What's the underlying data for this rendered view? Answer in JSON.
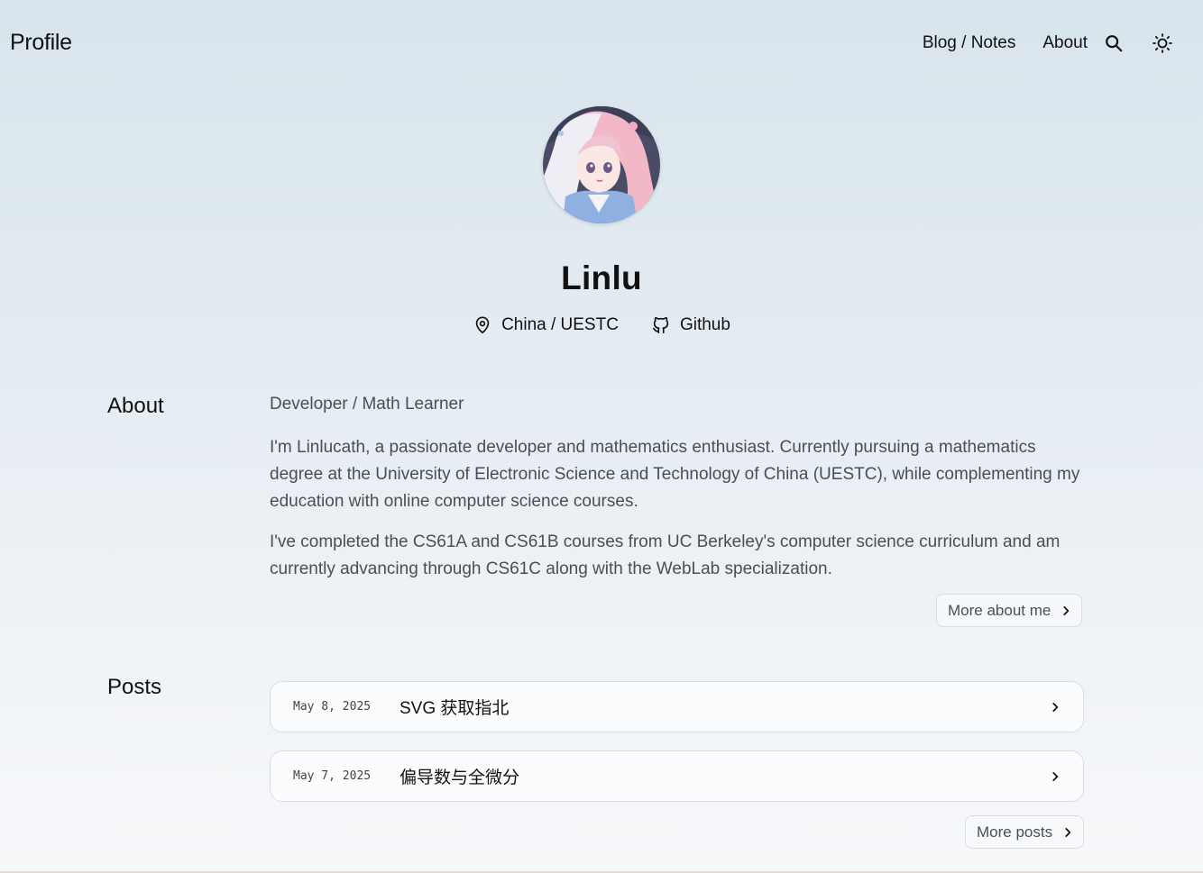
{
  "nav": {
    "brand": "Profile",
    "links": [
      "Blog / Notes",
      "About"
    ],
    "search_icon": "search-icon",
    "theme_icon": "sun-icon"
  },
  "profile": {
    "name": "Linlu",
    "location": "China / UESTC",
    "location_icon": "location-pin-icon",
    "github_label": "Github",
    "github_icon": "github-icon"
  },
  "about": {
    "title": "About",
    "role": "Developer / Math Learner",
    "paragraphs": [
      "I'm Linlucath, a passionate developer and mathematics enthusiast. Currently pursuing a mathematics degree at the University of Electronic Science and Technology of China (UESTC), while complementing my education with online computer science courses.",
      "I've completed the CS61A and CS61B courses from UC Berkeley's computer science curriculum and am currently advancing through CS61C along with the WebLab specialization."
    ],
    "more_label": "More about me"
  },
  "posts": {
    "title": "Posts",
    "items": [
      {
        "date": "May 8, 2025",
        "title": "SVG 获取指北"
      },
      {
        "date": "May 7, 2025",
        "title": "偏导数与全微分"
      }
    ],
    "more_label": "More posts"
  },
  "colors": {
    "bg_top": "#d8e4ec",
    "bg_bottom": "#f7f8fa",
    "text": "#111111",
    "muted": "#4a4f55",
    "border": "#d9dde2"
  }
}
